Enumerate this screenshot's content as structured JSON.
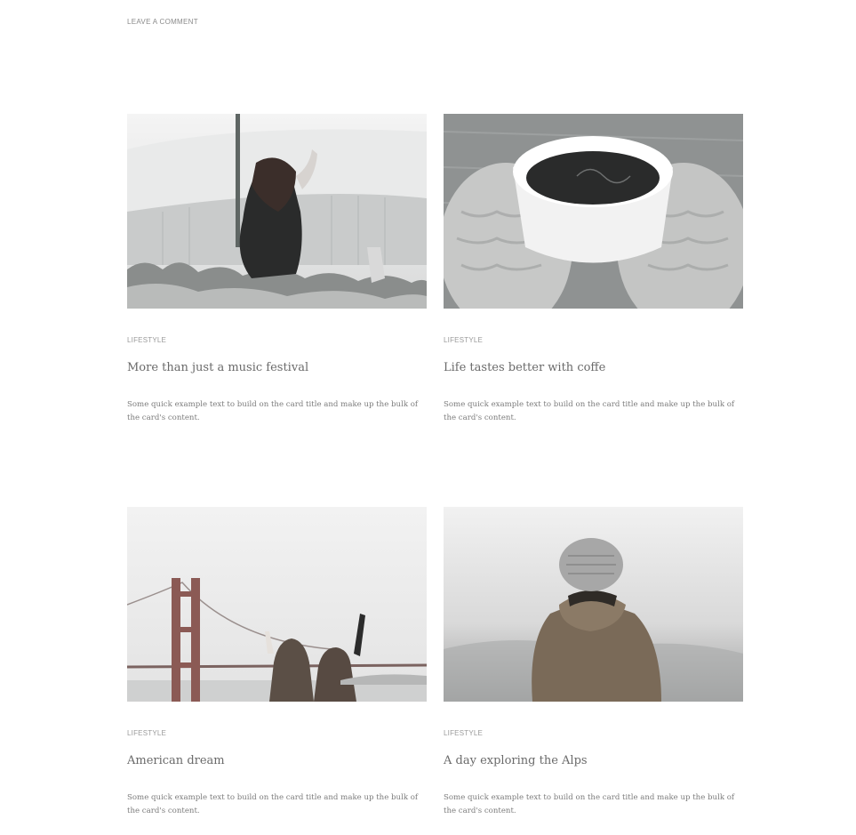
{
  "header": {
    "leave_comment": "LEAVE A COMMENT"
  },
  "posts": [
    {
      "category": "LIFESTYLE",
      "title": "More than just a music festival",
      "excerpt": "Some quick example text to build on the card title and make up the bulk of the card's content.",
      "image": "concert-crowd-photo"
    },
    {
      "category": "LIFESTYLE",
      "title": "Life tastes better with coffe",
      "excerpt": "Some quick example text to build on the card title and make up the bulk of the card's content.",
      "image": "coffee-cup-mittens-photo"
    },
    {
      "category": "LIFESTYLE",
      "title": "American dream",
      "excerpt": "Some quick example text to build on the card title and make up the bulk of the card's content.",
      "image": "golden-gate-bridge-friends-photo"
    },
    {
      "category": "LIFESTYLE",
      "title": "A day exploring the Alps",
      "excerpt": "Some quick example text to build on the card title and make up the bulk of the card's content.",
      "image": "hiker-beanie-fog-photo"
    }
  ]
}
